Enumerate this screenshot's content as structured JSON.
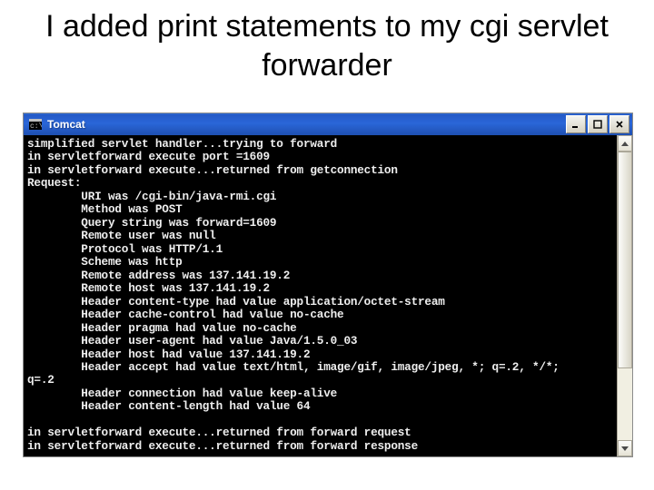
{
  "slide": {
    "title": "I added print statements to my cgi servlet forwarder"
  },
  "window": {
    "title": "Tomcat",
    "min_label": "_",
    "max_label": "□",
    "close_label": "×"
  },
  "console": {
    "lines": [
      "simplified servlet handler...trying to forward",
      "in servletforward execute port =1609",
      "in servletforward execute...returned from getconnection",
      "Request:",
      "        URI was /cgi-bin/java-rmi.cgi",
      "        Method was POST",
      "        Query string was forward=1609",
      "        Remote user was null",
      "        Protocol was HTTP/1.1",
      "        Scheme was http",
      "        Remote address was 137.141.19.2",
      "        Remote host was 137.141.19.2",
      "        Header content-type had value application/octet-stream",
      "        Header cache-control had value no-cache",
      "        Header pragma had value no-cache",
      "        Header user-agent had value Java/1.5.0_03",
      "        Header host had value 137.141.19.2",
      "        Header accept had value text/html, image/gif, image/jpeg, *; q=.2, */*;",
      "q=.2",
      "        Header connection had value keep-alive",
      "        Header content-length had value 64",
      "",
      "in servletforward execute...returned from forward request",
      "in servletforward execute...returned from forward response"
    ]
  }
}
